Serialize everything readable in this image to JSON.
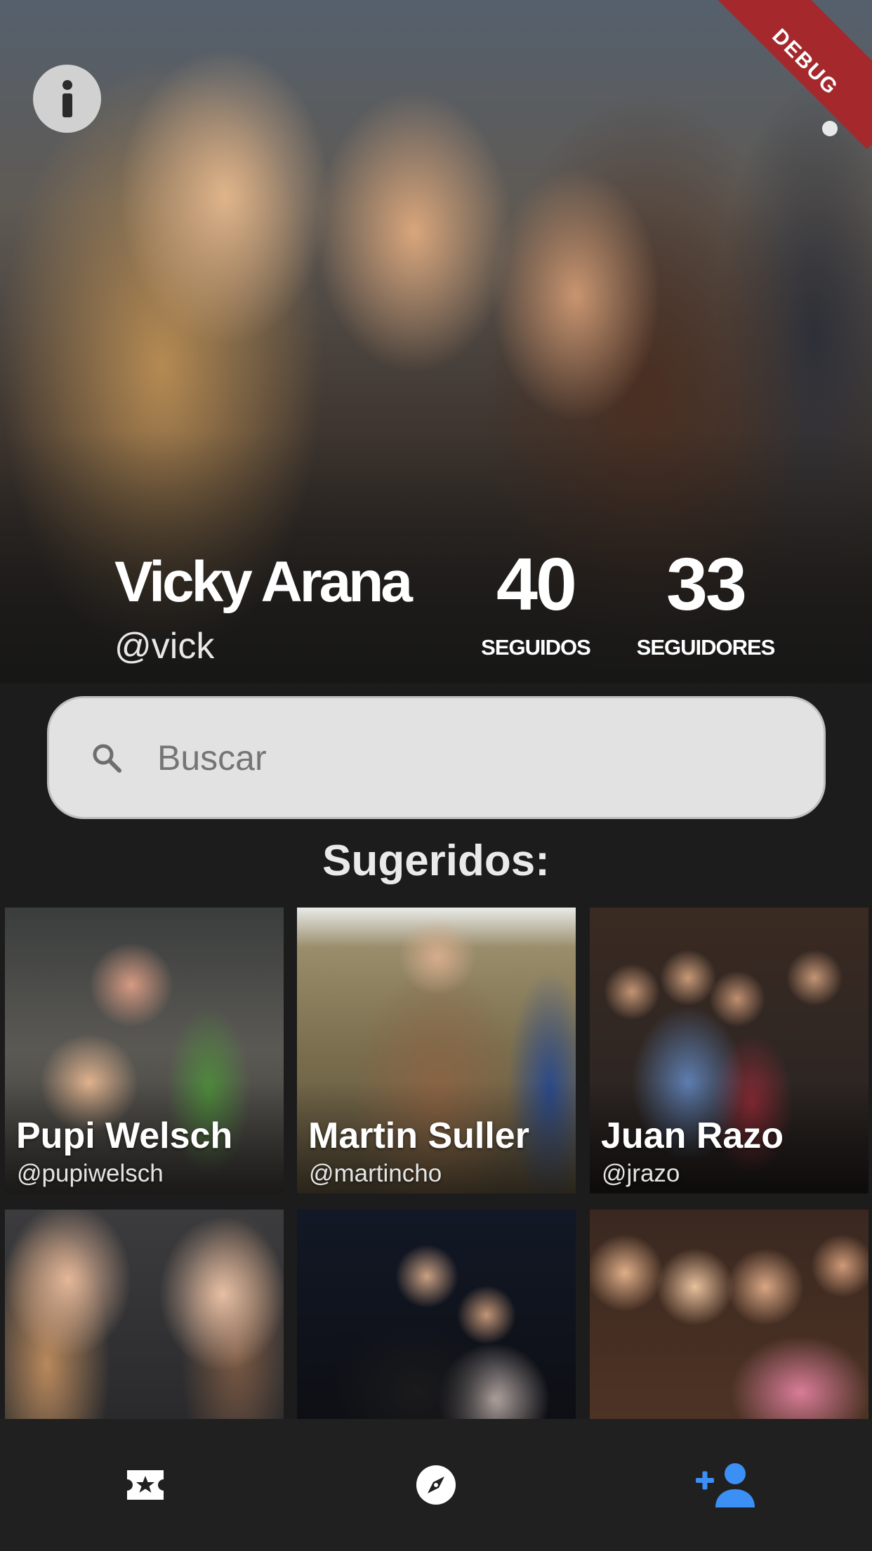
{
  "profile": {
    "name": "Vicky Arana",
    "handle": "@vick",
    "following_count": "40",
    "following_label": "SEGUIDOS",
    "followers_count": "33",
    "followers_label": "SEGUIDORES"
  },
  "debug_banner": "DEBUG",
  "icons": {
    "info": "info-icon",
    "more": "more-vertical-icon",
    "search": "search-icon",
    "nav_tickets": "ticket-star-icon",
    "nav_explore": "compass-icon",
    "nav_people": "person-add-icon"
  },
  "search": {
    "placeholder": "Buscar"
  },
  "suggested": {
    "title": "Sugeridos:",
    "users": [
      {
        "name": "Pupi Welsch",
        "handle": "@pupiwelsch"
      },
      {
        "name": "Martin Suller",
        "handle": "@martincho"
      },
      {
        "name": "Juan Razo",
        "handle": "@jrazo"
      },
      {
        "name": "",
        "handle": ""
      },
      {
        "name": "",
        "handle": ""
      },
      {
        "name": "",
        "handle": ""
      }
    ]
  },
  "nav": {
    "active": "people"
  },
  "colors": {
    "background": "#1c1c1d",
    "accent": "#3b8ff5",
    "debug_ribbon": "#a5282c",
    "search_bg": "#e2e2e2"
  }
}
